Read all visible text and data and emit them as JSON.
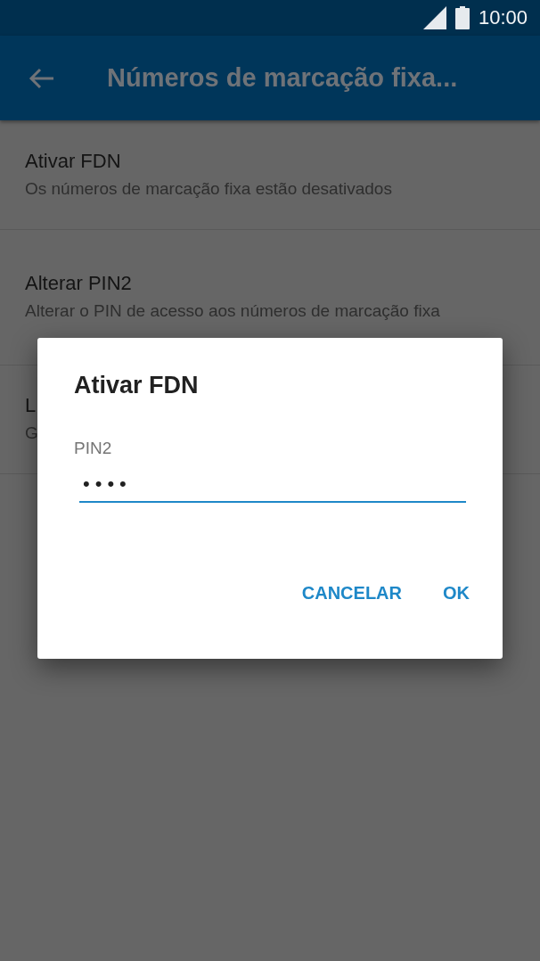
{
  "status_bar": {
    "time": "10:00"
  },
  "app_bar": {
    "title": "Números de marcação fixa..."
  },
  "settings": [
    {
      "title": "Ativar FDN",
      "subtitle": "Os números de marcação fixa estão desativados"
    },
    {
      "title": "Alterar PIN2",
      "subtitle": "Alterar o PIN de acesso aos números de marcação fixa"
    },
    {
      "title": "L",
      "subtitle": "G"
    }
  ],
  "dialog": {
    "title": "Ativar FDN",
    "field": {
      "label": "PIN2",
      "value": "••••"
    },
    "buttons": [
      "CANCELAR",
      "OK"
    ]
  }
}
